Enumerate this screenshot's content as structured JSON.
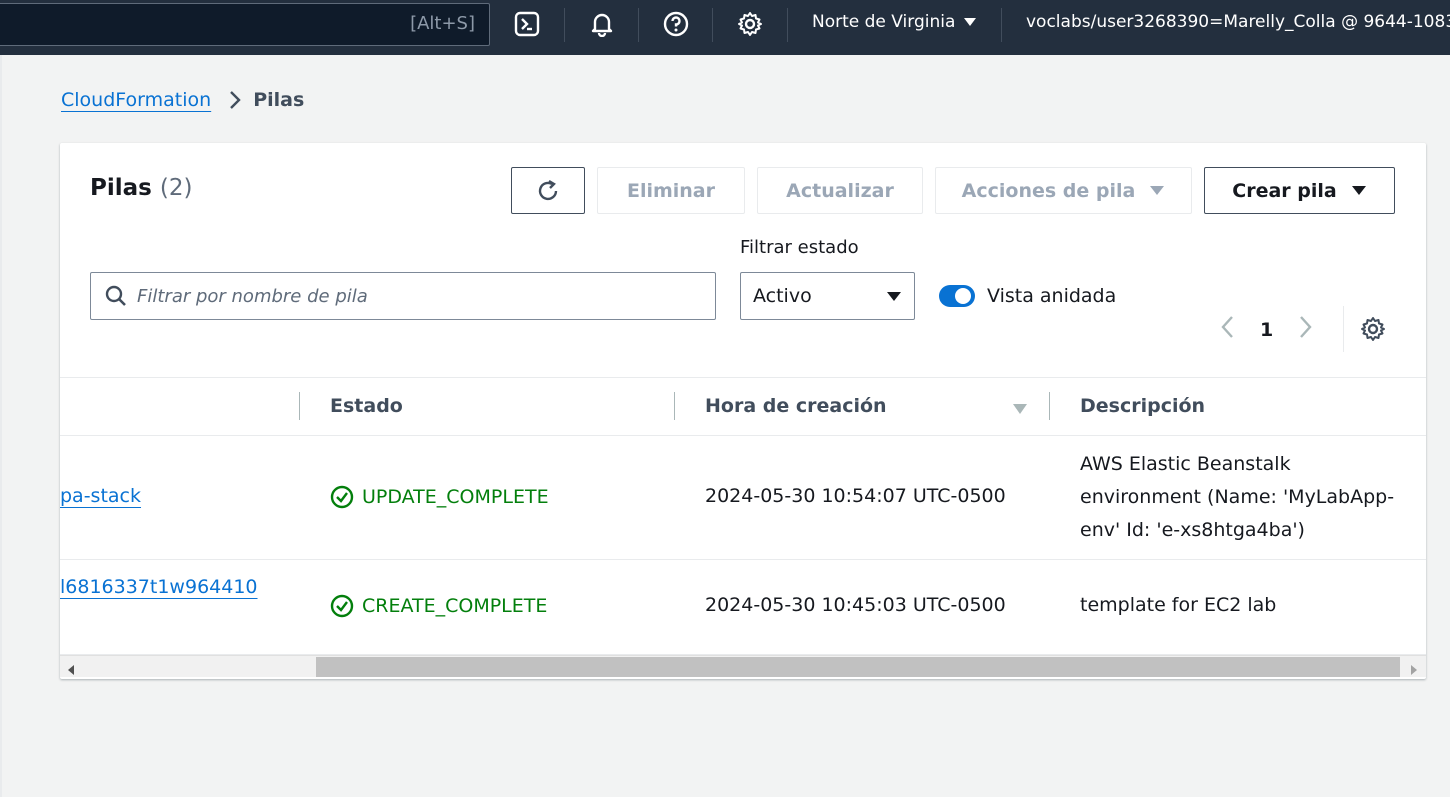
{
  "topbar": {
    "search_shortcut": "[Alt+S]",
    "region": "Norte de Virginia",
    "account": "voclabs/user3268390=Marelly_Colla @ 9644-1083-"
  },
  "breadcrumb": {
    "root": "CloudFormation",
    "current": "Pilas"
  },
  "panel": {
    "title": "Pilas",
    "count": "(2)",
    "buttons": {
      "delete": "Eliminar",
      "update": "Actualizar",
      "stack_actions": "Acciones de pila",
      "create": "Crear pila"
    },
    "search_placeholder": "Filtrar por nombre de pila",
    "filter_label": "Filtrar estado",
    "filter_value": "Activo",
    "nested_view_label": "Vista anidada",
    "page_number": "1"
  },
  "table": {
    "columns": [
      "Estado",
      "Hora de creación",
      "Descripción"
    ],
    "rows": [
      {
        "name": "pa-stack",
        "status": "UPDATE_COMPLETE",
        "created": "2024-05-30 10:54:07 UTC-0500",
        "description": "AWS Elastic Beanstalk environment (Name: 'MyLabApp-env' Id: 'e-xs8htga4ba')"
      },
      {
        "name": "l6816337t1w964410",
        "status": "CREATE_COMPLETE",
        "created": "2024-05-30 10:45:03 UTC-0500",
        "description": "template for EC2 lab"
      }
    ]
  },
  "colors": {
    "topbar_bg": "#232f3e",
    "link": "#0972d3",
    "success": "#037f0c",
    "toggle_on": "#0972d3"
  }
}
